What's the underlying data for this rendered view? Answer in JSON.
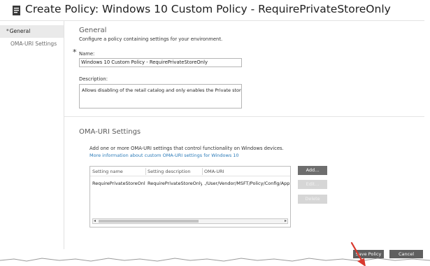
{
  "window": {
    "title": "Create Policy: Windows 10 Custom Policy - RequirePrivateStoreOnly"
  },
  "nav": {
    "items": [
      {
        "label": "General",
        "active": true,
        "required": true
      },
      {
        "label": "OMA-URI Settings",
        "active": false,
        "required": false
      }
    ]
  },
  "general": {
    "heading": "General",
    "description": "Configure a policy containing settings for your environment.",
    "name_label": "Name:",
    "name_value": "Windows 10 Custom Policy - RequirePrivateStoreOnly",
    "description_label": "Description:",
    "description_value": "Allows disabling of the retail catalog and only enables the Private store."
  },
  "oma": {
    "heading": "OMA-URI Settings",
    "intro": "Add one or more OMA-URI settings that control functionality on Windows devices.",
    "link": "More information about custom OMA-URI settings for Windows 10",
    "columns": [
      "Setting name",
      "Setting description",
      "OMA-URI"
    ],
    "rows": [
      {
        "name": "RequirePrivateStoreOnly",
        "description": "RequirePrivateStoreOnly",
        "uri": "./User/Vendor/MSFT/Policy/Config/Applic"
      }
    ],
    "add_label": "Add...",
    "edit_label": "Edit...",
    "delete_label": "Delete"
  },
  "footer": {
    "save_label": "Save Policy",
    "cancel_label": "Cancel"
  },
  "colors": {
    "accent_link": "#2a7ab8",
    "button_dark": "#5f5f5f",
    "arrow": "#d9382e"
  }
}
